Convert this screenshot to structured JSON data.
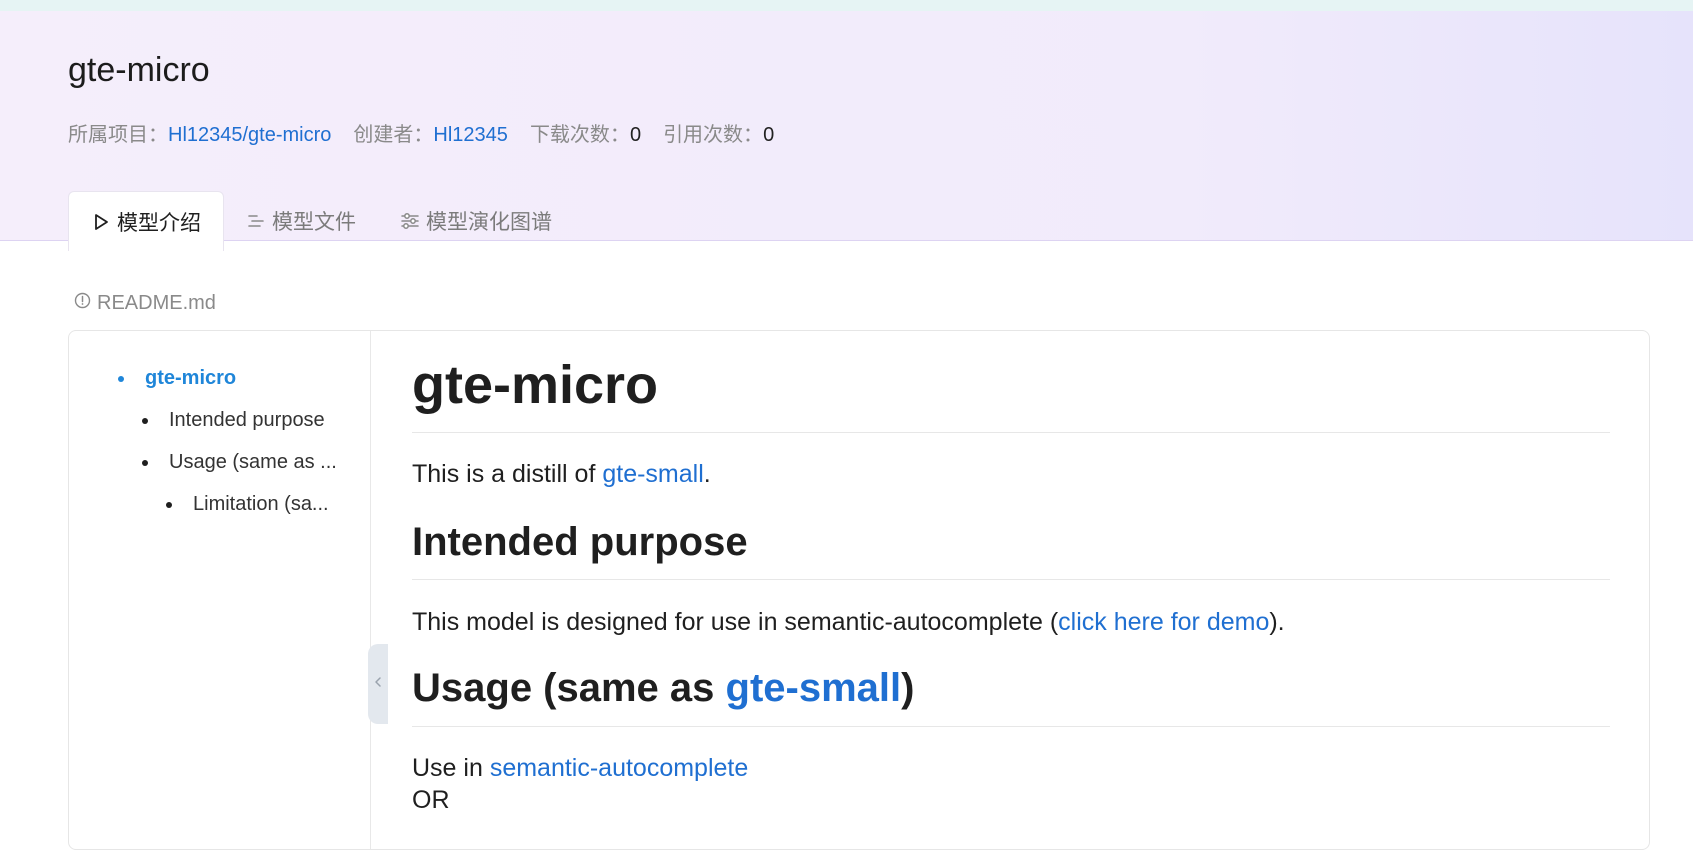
{
  "header": {
    "title": "gte-micro",
    "meta": {
      "project_label": "所属项目：",
      "project_value": "Hl12345/gte-micro",
      "creator_label": "创建者：",
      "creator_value": "Hl12345",
      "downloads_label": "下载次数：",
      "downloads_value": "0",
      "citations_label": "引用次数：",
      "citations_value": "0"
    }
  },
  "tabs": [
    {
      "label": "模型介绍",
      "icon": "play-icon",
      "active": true
    },
    {
      "label": "模型文件",
      "icon": "list-icon",
      "active": false
    },
    {
      "label": "模型演化图谱",
      "icon": "sliders-icon",
      "active": false
    }
  ],
  "readme": {
    "filename": "README.md",
    "icon": "info-icon"
  },
  "toc": [
    {
      "label": "gte-micro",
      "level": 1,
      "active": true
    },
    {
      "label": "Intended purpose",
      "level": 2,
      "active": false
    },
    {
      "label": "Usage (same as ...",
      "level": 2,
      "active": false
    },
    {
      "label": "Limitation (sa...",
      "level": 3,
      "active": false
    }
  ],
  "content": {
    "h1": "gte-micro",
    "intro_text": "This is a distill of ",
    "intro_link": "gte-small",
    "intro_end": ".",
    "h2_purpose": "Intended purpose",
    "purpose_text": "This model is designed for use in semantic-autocomplete (",
    "purpose_link": "click here for demo",
    "purpose_end": ").",
    "h2_usage_prefix": "Usage (same as ",
    "h2_usage_link": "gte-small",
    "h2_usage_suffix": ")",
    "usage_text": "Use in ",
    "usage_link": "semantic-autocomplete",
    "usage_next": "OR"
  },
  "colors": {
    "link": "#1f6fd1",
    "toc_active": "#1f86d9",
    "header_bg_start": "#f5eefb",
    "header_bg_end": "#e6e3fb"
  }
}
